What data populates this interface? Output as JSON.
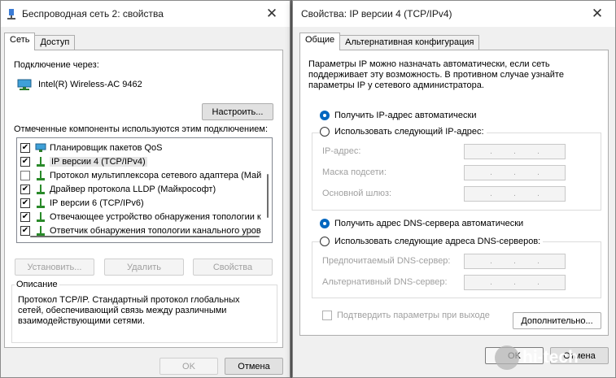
{
  "left_window": {
    "title": "Беспроводная сеть 2: свойства",
    "tabs": [
      "Сеть",
      "Доступ"
    ],
    "connect_using_label": "Подключение через:",
    "adapter_name": "Intel(R) Wireless-AC 9462",
    "configure_button": "Настроить...",
    "components_label": "Отмеченные компоненты используются этим подключением:",
    "components": [
      {
        "label": "Планировщик пакетов QoS",
        "checked": true,
        "icon": "network-service-icon"
      },
      {
        "label": "IP версии 4 (TCP/IPv4)",
        "checked": true,
        "icon": "protocol-icon"
      },
      {
        "label": "Протокол мультиплексора сетевого адаптера (Май",
        "checked": false,
        "icon": "protocol-icon"
      },
      {
        "label": "Драйвер протокола LLDP (Майкрософт)",
        "checked": true,
        "icon": "protocol-icon"
      },
      {
        "label": "IP версии 6 (TCP/IPv6)",
        "checked": true,
        "icon": "protocol-icon"
      },
      {
        "label": "Отвечающее устройство обнаружения топологии к",
        "checked": true,
        "icon": "protocol-icon"
      },
      {
        "label": "Ответчик обнаружения топологии канального уров",
        "checked": true,
        "icon": "protocol-icon"
      }
    ],
    "install_button": "Установить...",
    "uninstall_button": "Удалить",
    "properties_button": "Свойства",
    "description_title": "Описание",
    "description_lines": [
      "Протокол TCP/IP. Стандартный протокол глобальных",
      "сетей, обеспечивающий связь между различными",
      "взаимодействующими сетями."
    ],
    "ok_button": "OK",
    "cancel_button": "Отмена"
  },
  "right_window": {
    "title": "Свойства: IP версии 4 (TCP/IPv4)",
    "tabs": [
      "Общие",
      "Альтернативная конфигурация"
    ],
    "intro_lines": [
      "Параметры IP можно назначать автоматически, если сеть",
      "поддерживает эту возможность. В противном случае узнайте",
      "параметры IP у сетевого администратора."
    ],
    "ip_auto_radio": "Получить IP-адрес автоматически",
    "ip_manual_radio": "Использовать следующий IP-адрес:",
    "ip_address_label": "IP-адрес:",
    "subnet_mask_label": "Маска подсети:",
    "gateway_label": "Основной шлюз:",
    "dns_auto_radio": "Получить адрес DNS-сервера автоматически",
    "dns_manual_radio": "Использовать следующие адреса DNS-серверов:",
    "preferred_dns_label": "Предпочитаемый DNS-сервер:",
    "alternate_dns_label": "Альтернативный DNS-сервер:",
    "ip_dot": ".",
    "validate_checkbox": "Подтвердить параметры при выходе",
    "advanced_button": "Дополнительно...",
    "ok_button": "OK",
    "cancel_button": "Отмена"
  },
  "watermark": {
    "text": "hi-tech"
  },
  "close_glyph": "✕",
  "colors": {
    "accent": "#0067c0",
    "background": "#f0f0f0"
  }
}
